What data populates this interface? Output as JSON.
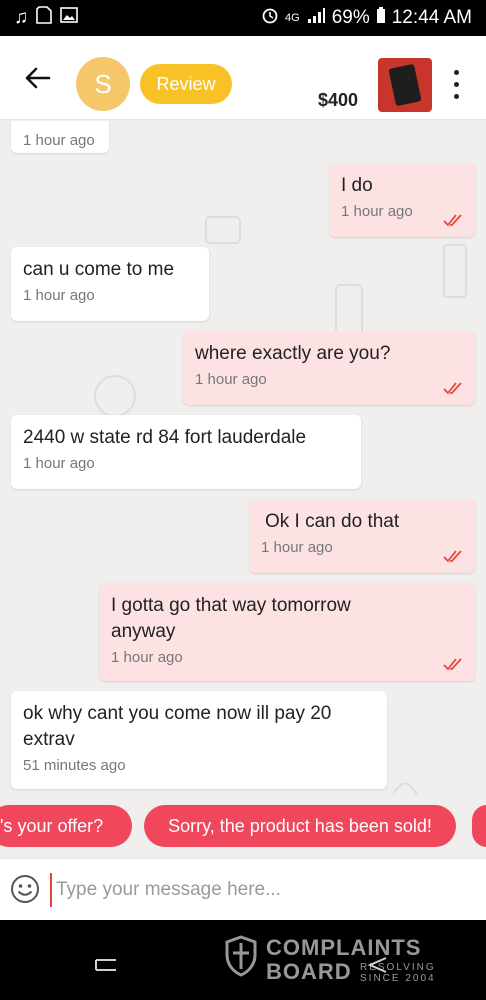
{
  "statusbar": {
    "battery": "69%",
    "time": "12:44 AM",
    "network": "4G"
  },
  "header": {
    "avatar_letter": "S",
    "review_label": "Review",
    "price": "$400"
  },
  "messages": [
    {
      "side": "recv",
      "text": "",
      "time": "1 hour ago"
    },
    {
      "side": "sent",
      "text": "I do",
      "time": "1 hour ago"
    },
    {
      "side": "recv",
      "text": "can u come to me",
      "time": "1 hour ago"
    },
    {
      "side": "sent",
      "text": "where exactly are you?",
      "time": "1 hour ago"
    },
    {
      "side": "recv",
      "text": "2440 w state rd 84 fort lauderdale",
      "time": "1 hour ago"
    },
    {
      "side": "sent",
      "text": "Ok I can do that",
      "time": "1 hour ago"
    },
    {
      "side": "sent",
      "text": "I gotta go that way tomorrow anyway",
      "time": "1 hour ago"
    },
    {
      "side": "recv",
      "text": "ok why cant you come now ill pay 20 extrav",
      "time": "51 minutes ago"
    }
  ],
  "quick_replies": [
    "'s your offer?",
    "Sorry, the product has been sold!"
  ],
  "composer": {
    "placeholder": "Type your message here..."
  },
  "watermark": {
    "line1": "COMPLAINTS",
    "line2": "BOARD",
    "tag1": "RESOLVING",
    "tag2": "SINCE 2004"
  },
  "colors": {
    "accent": "#f0475d",
    "review": "#f8c227",
    "avatar": "#f6c66b",
    "sent_bubble": "#fde2e4",
    "ticks": "#e6483d"
  },
  "icons": {
    "back": "arrow-left-icon",
    "more": "more-vertical-icon",
    "emoji": "smiley-icon",
    "read": "double-check-icon"
  }
}
